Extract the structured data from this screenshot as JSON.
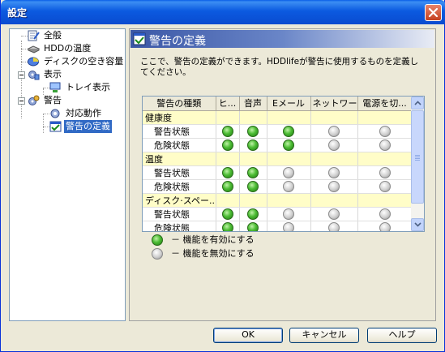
{
  "window": {
    "title": "設定",
    "close_label": "×"
  },
  "tree": {
    "items": [
      {
        "label": "全般"
      },
      {
        "label": "HDDの温度"
      },
      {
        "label": "ディスクの空き容量"
      },
      {
        "label": "表示"
      },
      {
        "label": "トレイ表示"
      },
      {
        "label": "警告"
      },
      {
        "label": "対応動作"
      },
      {
        "label": "警告の定義"
      }
    ]
  },
  "panel": {
    "title": "警告の定義",
    "description": "ここで、警告の定義ができます。HDDlifeが警告に使用するものを定義してください。"
  },
  "grid": {
    "columns": [
      "警告の種類",
      "ヒ...",
      "音声",
      "Eメール",
      "ネットワー...",
      "電源を切..."
    ],
    "groups": [
      {
        "name": "健康度",
        "rows": [
          {
            "label": "警告状態",
            "states": [
              true,
              true,
              true,
              false,
              false
            ]
          },
          {
            "label": "危険状態",
            "states": [
              true,
              true,
              true,
              false,
              false
            ]
          }
        ]
      },
      {
        "name": "温度",
        "rows": [
          {
            "label": "警告状態",
            "states": [
              true,
              true,
              false,
              false,
              false
            ]
          },
          {
            "label": "危険状態",
            "states": [
              true,
              true,
              false,
              false,
              false
            ]
          }
        ]
      },
      {
        "name": "ディスク·スペー...",
        "rows": [
          {
            "label": "警告状態",
            "states": [
              true,
              true,
              false,
              false,
              false
            ]
          },
          {
            "label": "危険状態",
            "states": [
              true,
              true,
              false,
              false,
              false
            ]
          }
        ]
      }
    ]
  },
  "legend": {
    "enabled": "－ 機能を有効にする",
    "disabled": "－ 機能を無効にする"
  },
  "buttons": {
    "ok": "OK",
    "cancel": "キャンセル",
    "help": "ヘルプ"
  },
  "colors": {
    "title_bar": "#0a5fe8",
    "selection": "#316ac5",
    "group_row": "#fffdc8",
    "enabled": "#4cbc34",
    "disabled": "#cfcfcf"
  },
  "icons": {
    "general": "document-pen-icon",
    "temperature": "hdd-icon",
    "disk_space": "disk-pie-icon",
    "display": "gears-icon",
    "tray": "tray-monitor-icon",
    "alerts": "gears-warning-icon",
    "actions": "gear-small-icon",
    "alert_definition": "checkbox-window-icon"
  }
}
